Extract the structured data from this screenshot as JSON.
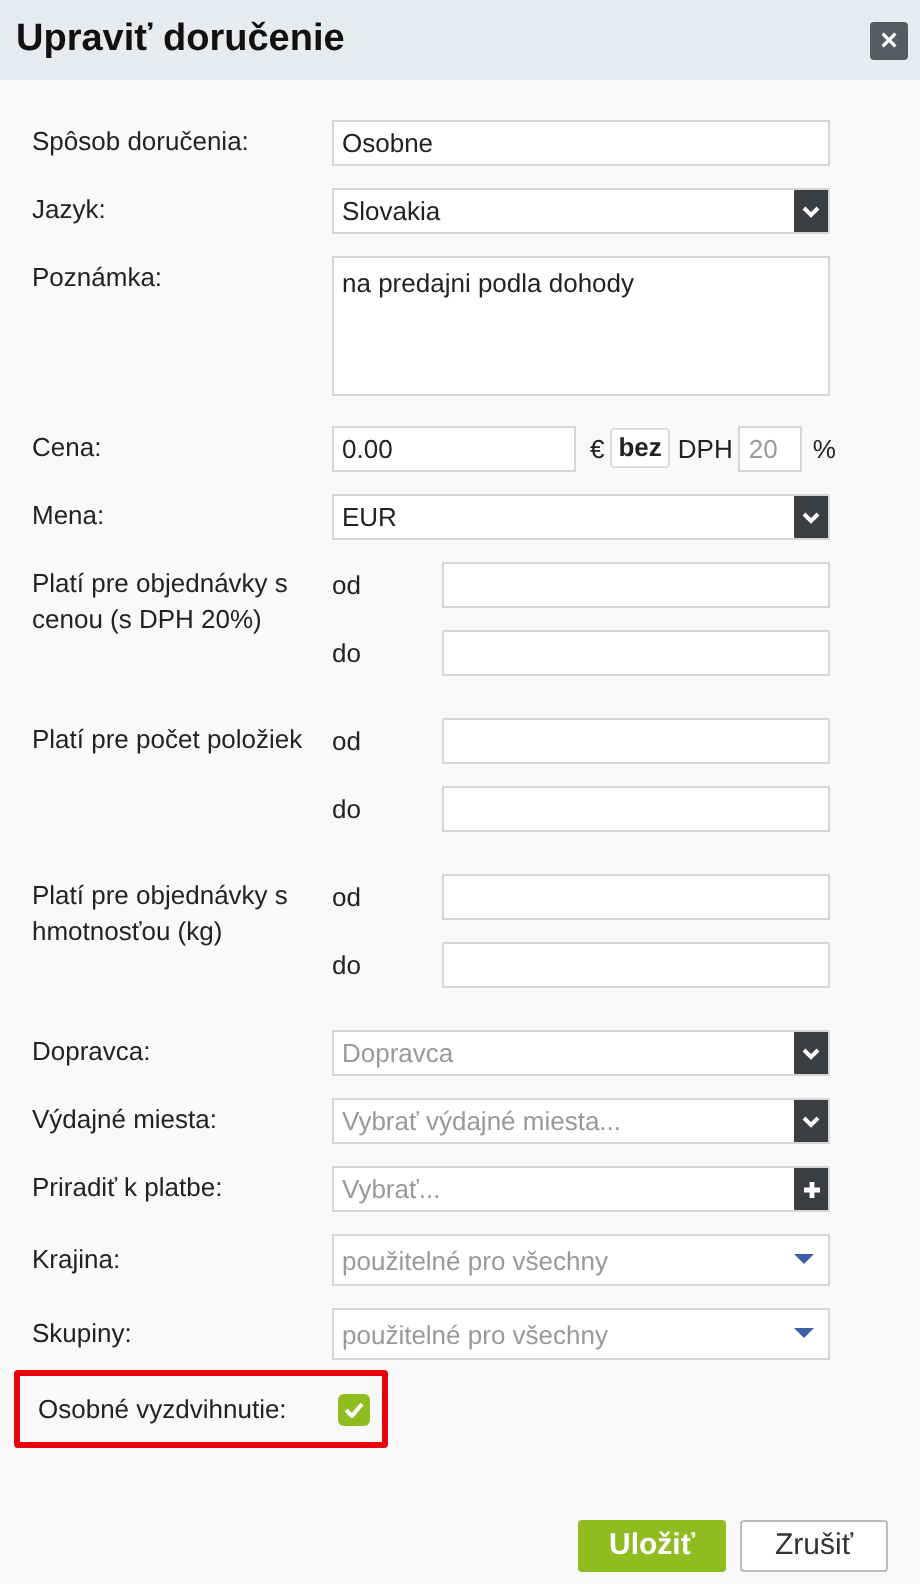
{
  "dialog": {
    "title": "Upraviť doručenie",
    "close": "×"
  },
  "fields": [
    {
      "kind": "text",
      "label": "Spôsob doručenia:",
      "value": "Osobne"
    },
    {
      "kind": "select",
      "label": "Jazyk:",
      "value": "Slovakia"
    },
    {
      "kind": "textarea",
      "label": "Poznámka:",
      "value": "na predajni podla dohody"
    },
    {
      "kind": "price",
      "label": "Cena:",
      "value": "0.00",
      "currency": "€",
      "tax_toggle": "bez",
      "tax_label": "DPH",
      "tax_placeholder": "20",
      "percent": "%"
    },
    {
      "kind": "select",
      "label": "Mena:",
      "value": "EUR"
    },
    {
      "kind": "range",
      "label": "Platí pre objednávky s cenou (s DPH 20%)",
      "from": "od",
      "to": "do"
    },
    {
      "kind": "range",
      "label": "Platí pre počet položiek",
      "from": "od",
      "to": "do"
    },
    {
      "kind": "range",
      "label": "Platí pre objednávky s hmotnosťou (kg)",
      "from": "od",
      "to": "do"
    },
    {
      "kind": "select",
      "label": "Dopravca:",
      "placeholder": "Dopravca"
    },
    {
      "kind": "select",
      "label": "Výdajné miesta:",
      "placeholder": "Vybrať výdajné miesta..."
    },
    {
      "kind": "add",
      "label": "Priradiť k platbe:",
      "placeholder": "Vybrať..."
    },
    {
      "kind": "multiselect",
      "label": "Krajina:",
      "placeholder": "použitelné pro všechny"
    },
    {
      "kind": "multiselect",
      "label": "Skupiny:",
      "placeholder": "použitelné pro všechny"
    },
    {
      "kind": "checkbox",
      "label": "Osobné vyzdvihnutie:",
      "checked": true,
      "highlighted": true
    }
  ],
  "buttons": [
    {
      "kind": "primary",
      "label": "Uložiť"
    },
    {
      "kind": "secondary",
      "label": "Zrušiť"
    }
  ]
}
